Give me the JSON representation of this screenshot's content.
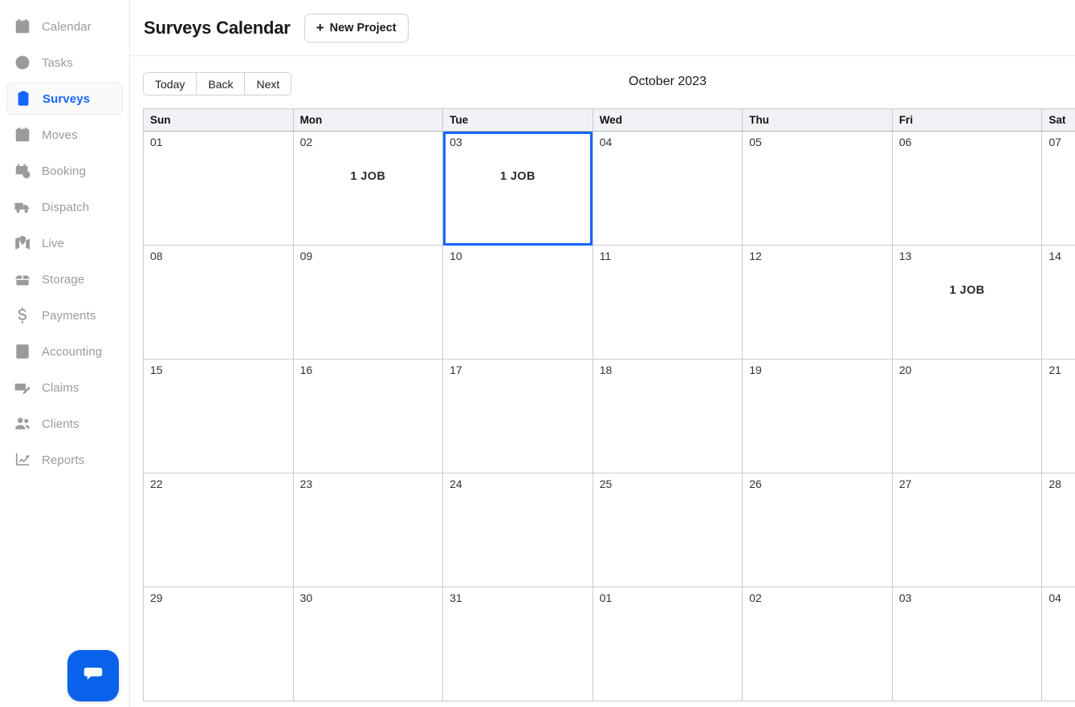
{
  "sidebar": {
    "items": [
      {
        "label": "Calendar",
        "icon": "calendar-check-icon",
        "active": false
      },
      {
        "label": "Tasks",
        "icon": "check-circle-icon",
        "active": false
      },
      {
        "label": "Surveys",
        "icon": "clipboard-list-icon",
        "active": true
      },
      {
        "label": "Moves",
        "icon": "calendar-check-icon",
        "active": false
      },
      {
        "label": "Booking",
        "icon": "calendar-clock-icon",
        "active": false
      },
      {
        "label": "Dispatch",
        "icon": "truck-icon",
        "active": false
      },
      {
        "label": "Live",
        "icon": "map-pin-icon",
        "active": false
      },
      {
        "label": "Storage",
        "icon": "open-box-icon",
        "active": false
      },
      {
        "label": "Payments",
        "icon": "dollar-sign-icon",
        "active": false
      },
      {
        "label": "Accounting",
        "icon": "calculator-icon",
        "active": false
      },
      {
        "label": "Claims",
        "icon": "invoice-edit-icon",
        "active": false
      },
      {
        "label": "Clients",
        "icon": "users-icon",
        "active": false
      },
      {
        "label": "Reports",
        "icon": "chart-line-icon",
        "active": false
      }
    ],
    "chat_widget": {
      "icon": "chat-bubble-icon"
    }
  },
  "header": {
    "title": "Surveys Calendar",
    "new_project_label": "New Project",
    "new_project_icon": "plus-icon"
  },
  "calendar": {
    "toolbar": {
      "today_label": "Today",
      "back_label": "Back",
      "next_label": "Next"
    },
    "month_label": "October 2023",
    "weekday_headers": [
      "Sun",
      "Mon",
      "Tue",
      "Wed",
      "Thu",
      "Fri",
      "Sat"
    ],
    "selected_weekday_index": 2,
    "colors": {
      "accent": "#1565ff",
      "selected_cell_bg": "#e4ecfb",
      "past_cell_bg": "#f1f3f6",
      "header_bg": "#f1f2f5",
      "chat_blue": "#0a62ea"
    },
    "weeks": [
      [
        {
          "day": "01",
          "jobs": "",
          "past": true,
          "selected": false
        },
        {
          "day": "02",
          "jobs": "1 JOB",
          "past": true,
          "selected": false
        },
        {
          "day": "03",
          "jobs": "1 JOB",
          "past": false,
          "selected": true
        },
        {
          "day": "04",
          "jobs": "",
          "past": false,
          "selected": false
        },
        {
          "day": "05",
          "jobs": "",
          "past": false,
          "selected": false
        },
        {
          "day": "06",
          "jobs": "",
          "past": false,
          "selected": false
        },
        {
          "day": "07",
          "jobs": "",
          "past": false,
          "selected": false
        }
      ],
      [
        {
          "day": "08",
          "jobs": "",
          "past": false,
          "selected": false
        },
        {
          "day": "09",
          "jobs": "",
          "past": false,
          "selected": false
        },
        {
          "day": "10",
          "jobs": "",
          "past": false,
          "selected": false
        },
        {
          "day": "11",
          "jobs": "",
          "past": false,
          "selected": false
        },
        {
          "day": "12",
          "jobs": "",
          "past": false,
          "selected": false
        },
        {
          "day": "13",
          "jobs": "1 JOB",
          "past": false,
          "selected": false
        },
        {
          "day": "14",
          "jobs": "",
          "past": false,
          "selected": false
        }
      ],
      [
        {
          "day": "15",
          "jobs": "",
          "past": false,
          "selected": false
        },
        {
          "day": "16",
          "jobs": "",
          "past": false,
          "selected": false
        },
        {
          "day": "17",
          "jobs": "",
          "past": false,
          "selected": false
        },
        {
          "day": "18",
          "jobs": "",
          "past": false,
          "selected": false
        },
        {
          "day": "19",
          "jobs": "",
          "past": false,
          "selected": false
        },
        {
          "day": "20",
          "jobs": "",
          "past": false,
          "selected": false
        },
        {
          "day": "21",
          "jobs": "",
          "past": false,
          "selected": false
        }
      ],
      [
        {
          "day": "22",
          "jobs": "",
          "past": false,
          "selected": false
        },
        {
          "day": "23",
          "jobs": "",
          "past": false,
          "selected": false
        },
        {
          "day": "24",
          "jobs": "",
          "past": false,
          "selected": false
        },
        {
          "day": "25",
          "jobs": "",
          "past": false,
          "selected": false
        },
        {
          "day": "26",
          "jobs": "",
          "past": false,
          "selected": false
        },
        {
          "day": "27",
          "jobs": "",
          "past": false,
          "selected": false
        },
        {
          "day": "28",
          "jobs": "",
          "past": false,
          "selected": false
        }
      ],
      [
        {
          "day": "29",
          "jobs": "",
          "past": false,
          "selected": false
        },
        {
          "day": "30",
          "jobs": "",
          "past": false,
          "selected": false
        },
        {
          "day": "31",
          "jobs": "",
          "past": false,
          "selected": false
        },
        {
          "day": "01",
          "jobs": "",
          "past": false,
          "selected": false
        },
        {
          "day": "02",
          "jobs": "",
          "past": false,
          "selected": false
        },
        {
          "day": "03",
          "jobs": "",
          "past": false,
          "selected": false
        },
        {
          "day": "04",
          "jobs": "",
          "past": false,
          "selected": false
        }
      ]
    ]
  }
}
